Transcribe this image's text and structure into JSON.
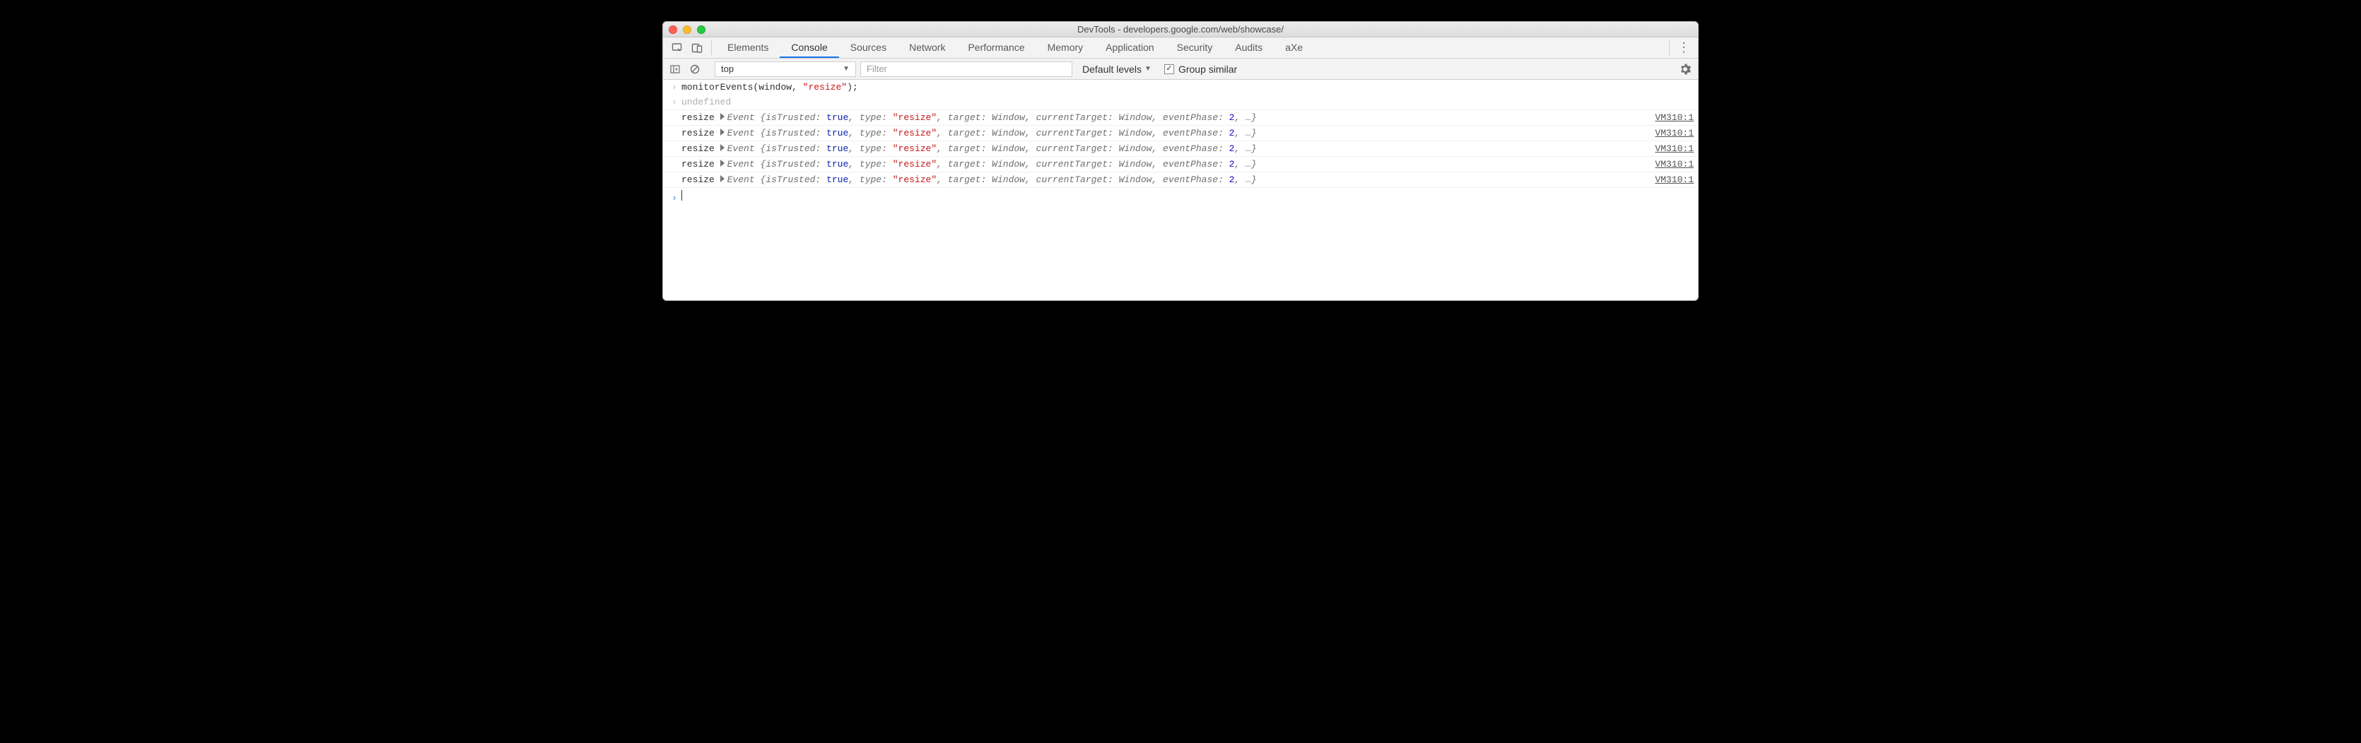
{
  "window": {
    "title": "DevTools - developers.google.com/web/showcase/"
  },
  "tabs": {
    "items": [
      "Elements",
      "Console",
      "Sources",
      "Network",
      "Performance",
      "Memory",
      "Application",
      "Security",
      "Audits",
      "aXe"
    ],
    "active": "Console"
  },
  "console_toolbar": {
    "context": "top",
    "filter_placeholder": "Filter",
    "levels_label": "Default levels",
    "group_label": "Group similar",
    "group_checked": true
  },
  "console": {
    "input_command": {
      "fn": "monitorEvents",
      "arg1": "window",
      "arg2_quote": "\"resize\"",
      "close": ");"
    },
    "return_value": "undefined",
    "events": [
      {
        "label": "resize",
        "class": "Event",
        "isTrusted": "true",
        "type": "\"resize\"",
        "target": "Window",
        "currentTarget": "Window",
        "eventPhase": "2",
        "source": "VM310:1"
      },
      {
        "label": "resize",
        "class": "Event",
        "isTrusted": "true",
        "type": "\"resize\"",
        "target": "Window",
        "currentTarget": "Window",
        "eventPhase": "2",
        "source": "VM310:1"
      },
      {
        "label": "resize",
        "class": "Event",
        "isTrusted": "true",
        "type": "\"resize\"",
        "target": "Window",
        "currentTarget": "Window",
        "eventPhase": "2",
        "source": "VM310:1"
      },
      {
        "label": "resize",
        "class": "Event",
        "isTrusted": "true",
        "type": "\"resize\"",
        "target": "Window",
        "currentTarget": "Window",
        "eventPhase": "2",
        "source": "VM310:1"
      },
      {
        "label": "resize",
        "class": "Event",
        "isTrusted": "true",
        "type": "\"resize\"",
        "target": "Window",
        "currentTarget": "Window",
        "eventPhase": "2",
        "source": "VM310:1"
      }
    ]
  }
}
